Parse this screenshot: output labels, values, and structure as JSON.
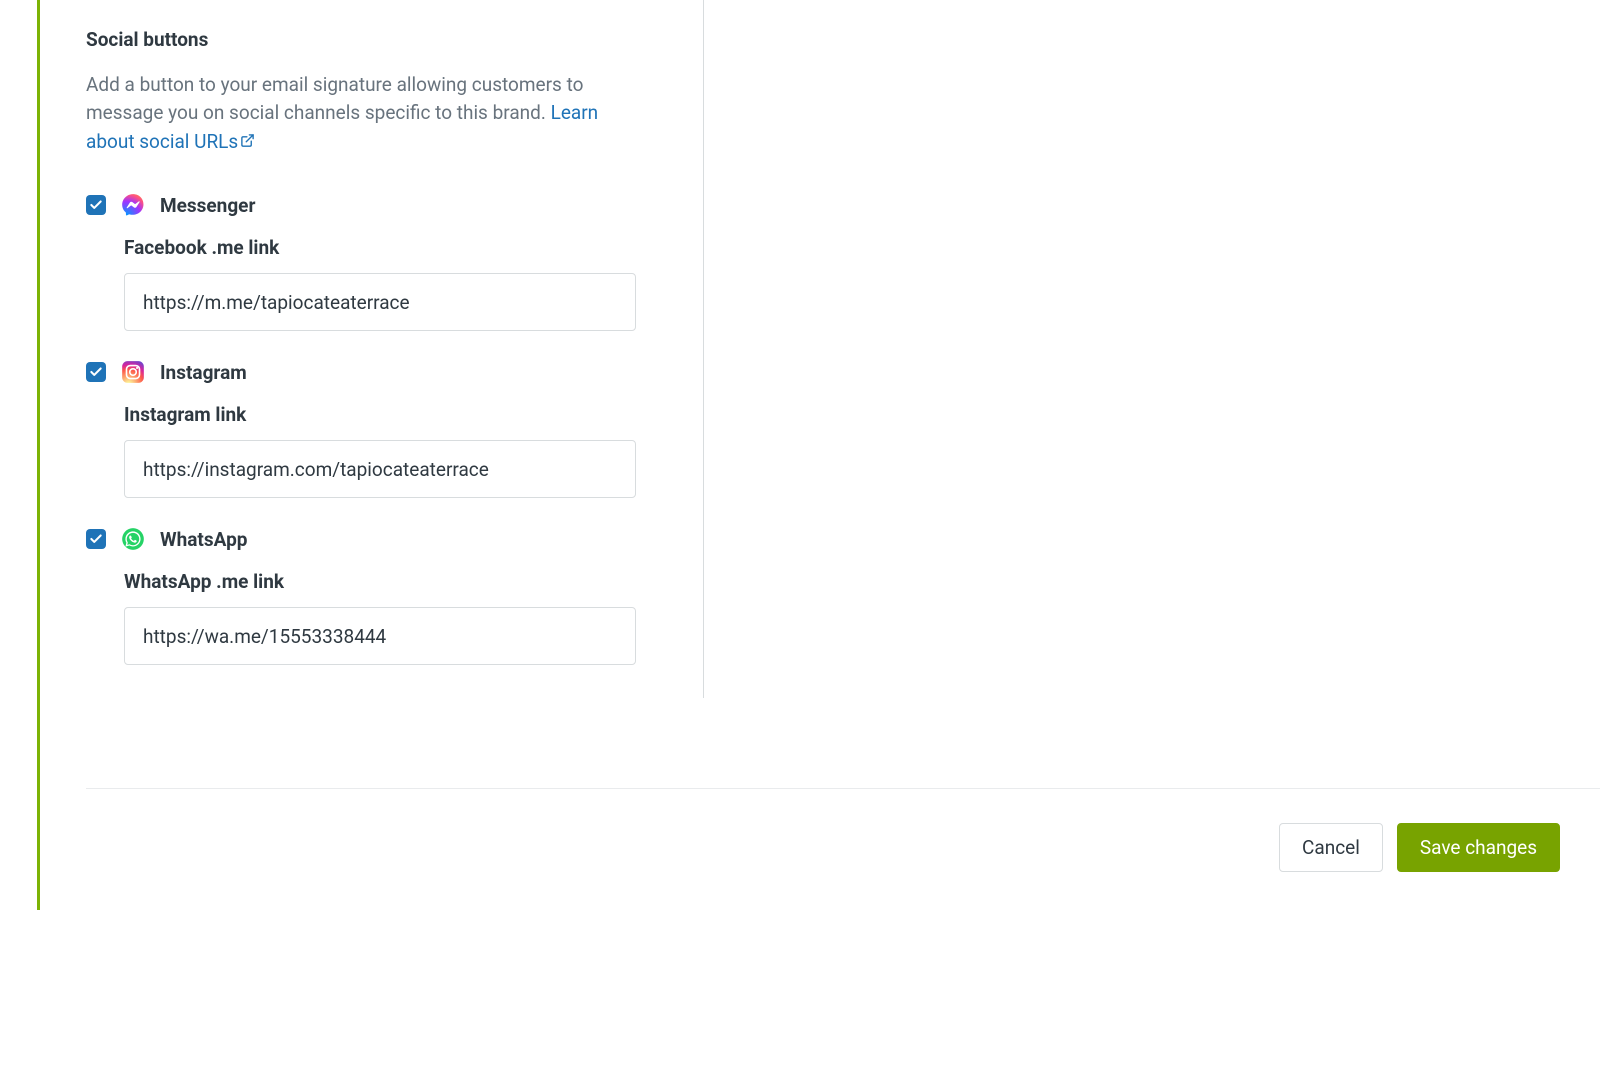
{
  "section": {
    "title": "Social buttons",
    "description_pre": "Add a button to your email signature allowing customers to message you on social channels specific to this brand. ",
    "learn_link": "Learn about social URLs"
  },
  "channels": [
    {
      "id": "messenger",
      "name": "Messenger",
      "checked": true,
      "link_label": "Facebook .me link",
      "link_value": "https://m.me/tapiocateaterrace"
    },
    {
      "id": "instagram",
      "name": "Instagram",
      "checked": true,
      "link_label": "Instagram link",
      "link_value": "https://instagram.com/tapiocateaterrace"
    },
    {
      "id": "whatsapp",
      "name": "WhatsApp",
      "checked": true,
      "link_label": "WhatsApp .me link",
      "link_value": "https://wa.me/15553338444"
    }
  ],
  "footer": {
    "cancel_label": "Cancel",
    "save_label": "Save changes"
  }
}
